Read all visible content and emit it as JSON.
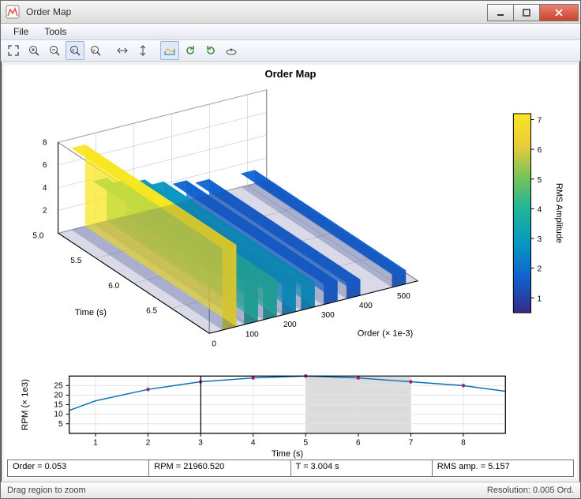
{
  "window_title": "Order Map",
  "menus": {
    "file": "File",
    "tools": "Tools"
  },
  "chart_title": "Order Map",
  "axis3d": {
    "time_label": "Time (s)",
    "order_label": "Order (× 1e-3)"
  },
  "colorbar_label": "RMS Amplitude",
  "rpm_ylabel": "RPM (× 1e3)",
  "rpm_xlabel": "Time (s)",
  "info": {
    "order": "Order = 0.053",
    "rpm": "RPM = 21960.520",
    "t": "T = 3.004 s",
    "rms": "RMS amp. = 5.157"
  },
  "status_left": "Drag region to zoom",
  "status_right": "Resolution: 0.005 Ord.",
  "chart_data": {
    "type": "area",
    "title": "Order Map",
    "xlabel": "Order (× 1e-3)",
    "ylabel": "Time (s)",
    "zlabel": "RMS Amplitude",
    "order_ticks": [
      0,
      100,
      200,
      300,
      400,
      500
    ],
    "time_ticks": [
      5.0,
      5.5,
      6.0,
      6.5
    ],
    "z_ticks": [
      2,
      4,
      6,
      8
    ],
    "color_ticks": [
      1,
      2,
      3,
      4,
      5,
      6,
      7
    ],
    "order_range": [
      0,
      550
    ],
    "time_range": [
      5.0,
      7.0
    ],
    "z_range": [
      0,
      8
    ],
    "ridges": [
      {
        "order": 53,
        "amp": 7.2
      },
      {
        "order": 110,
        "amp": 3.8
      },
      {
        "order": 160,
        "amp": 3.2
      },
      {
        "order": 210,
        "amp": 2.8
      },
      {
        "order": 260,
        "amp": 2.2
      },
      {
        "order": 320,
        "amp": 1.8
      },
      {
        "order": 380,
        "amp": 1.4
      },
      {
        "order": 500,
        "amp": 1.2
      }
    ]
  },
  "rpm_chart": {
    "type": "line",
    "xlabel": "Time (s)",
    "ylabel": "RPM (× 1e3)",
    "x_ticks": [
      1,
      2,
      3,
      4,
      5,
      6,
      7,
      8
    ],
    "y_ticks": [
      5,
      10,
      15,
      20,
      25
    ],
    "x": [
      0.5,
      1,
      2,
      3,
      4,
      5,
      6,
      7,
      8,
      8.8
    ],
    "y": [
      12,
      17,
      23,
      27,
      29,
      30,
      29,
      27,
      25,
      22
    ],
    "markers_x": [
      2,
      3,
      4,
      5,
      6,
      7,
      8
    ],
    "markers_y": [
      23,
      27,
      29,
      30,
      29,
      27,
      25
    ],
    "cursor_x": 3.004,
    "sel_range": [
      5.0,
      7.0
    ],
    "ylim": [
      0,
      30
    ],
    "xlim": [
      0.5,
      8.8
    ]
  }
}
